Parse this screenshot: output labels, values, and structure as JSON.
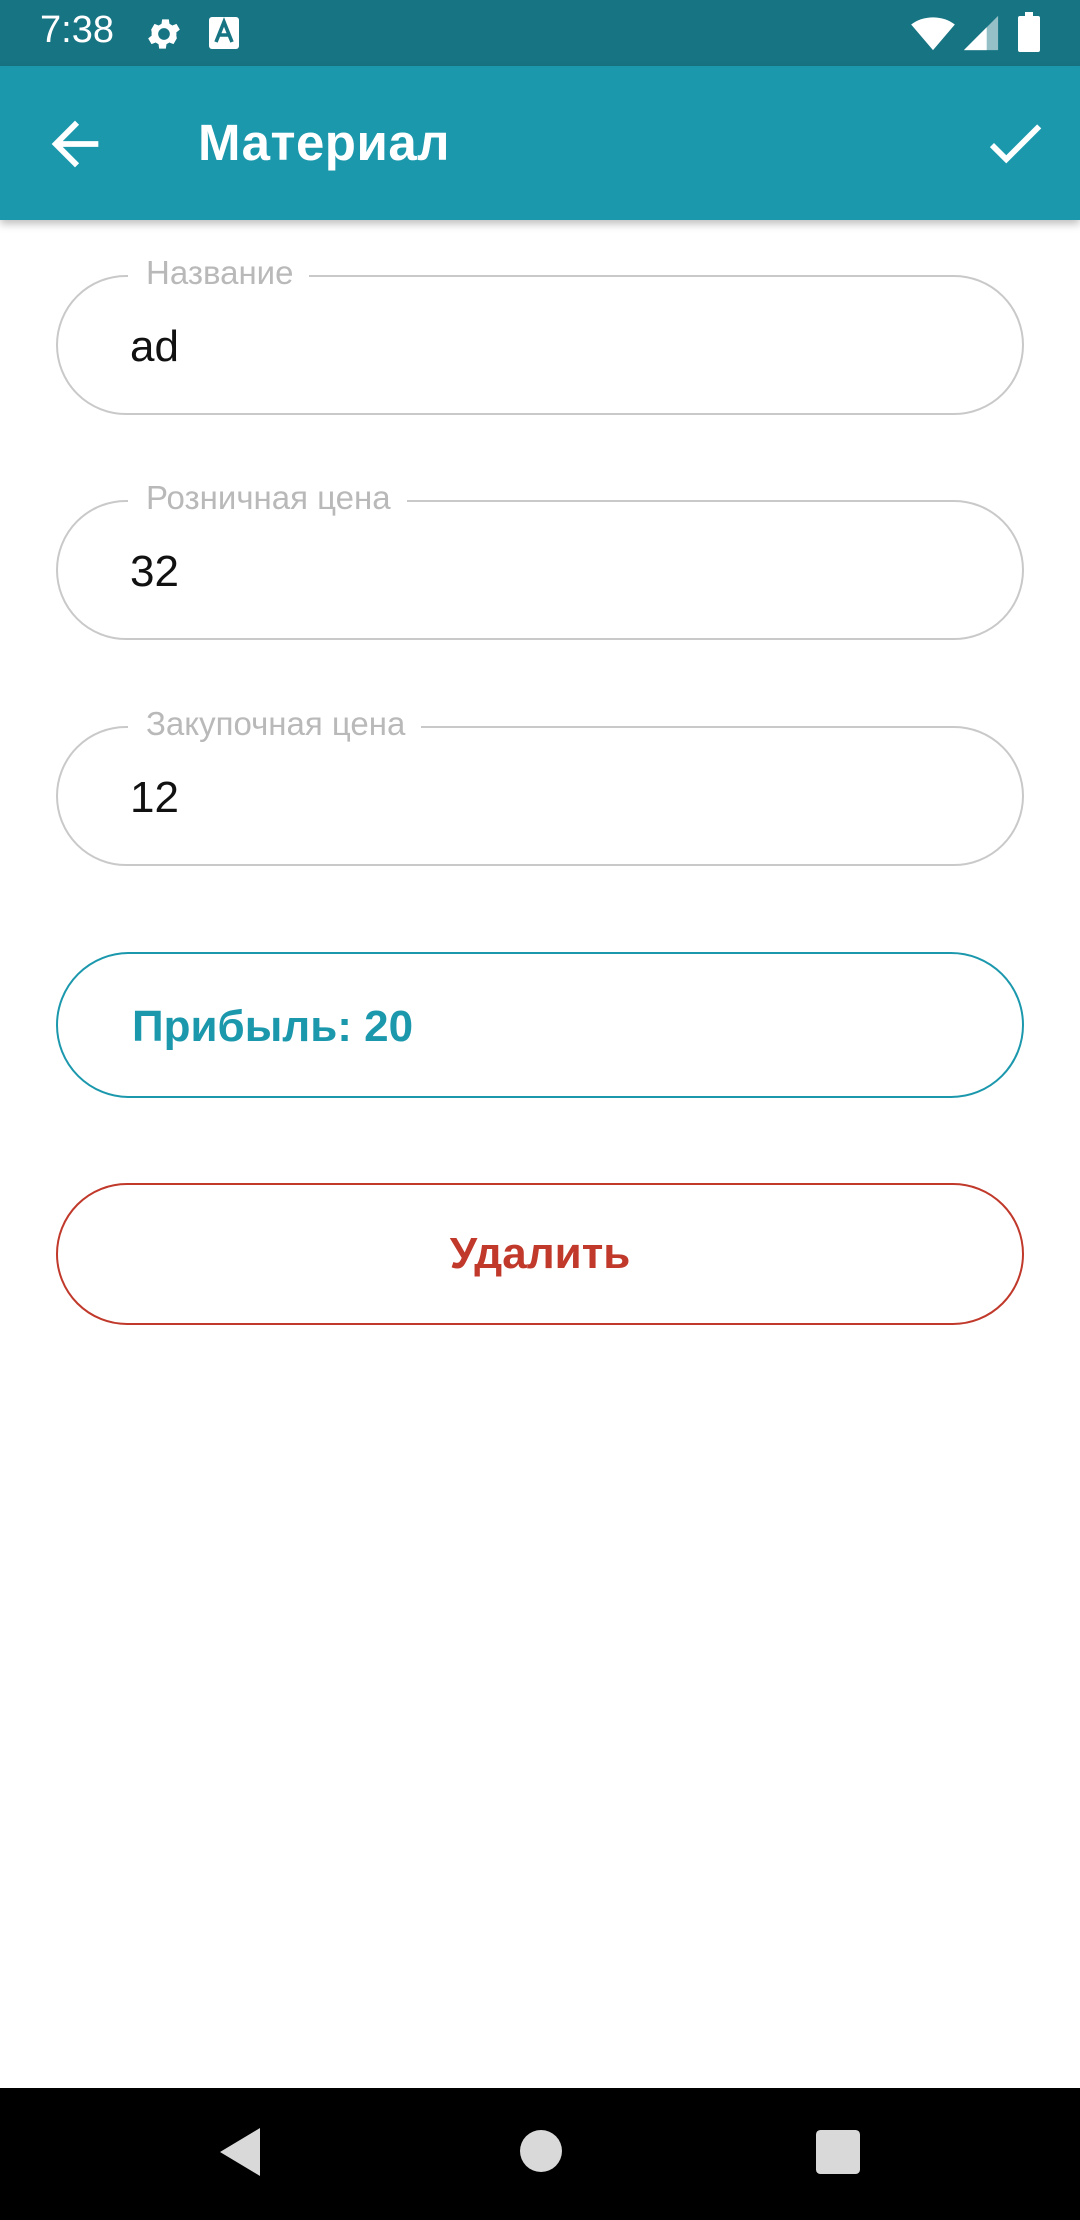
{
  "status_bar": {
    "time": "7:38",
    "icons": [
      "gear-icon",
      "keyboard-a-icon",
      "wifi-icon",
      "signal-icon",
      "battery-icon"
    ],
    "background": "#177483"
  },
  "app_bar": {
    "title": "Материал",
    "back_icon": "arrow-left-icon",
    "save_icon": "check-icon",
    "background": "#1c98ad"
  },
  "form": {
    "name": {
      "label": "Название",
      "value": "ad"
    },
    "retail_price": {
      "label": "Розничная цена",
      "value": "32"
    },
    "purchase_price": {
      "label": "Закупочная цена",
      "value": "12"
    }
  },
  "profit": {
    "text": "Прибыль: 20",
    "color": "#1c98ad"
  },
  "delete_button": {
    "label": "Удалить",
    "color": "#c0392b"
  },
  "nav_bar": {
    "icons": [
      "triangle-back-icon",
      "circle-home-icon",
      "square-recents-icon"
    ]
  }
}
